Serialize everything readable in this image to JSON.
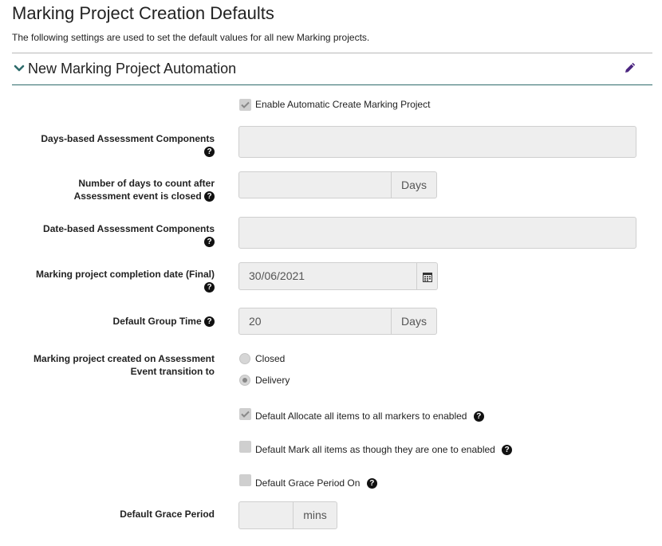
{
  "page": {
    "title": "Marking Project Creation Defaults",
    "subtitle": "The following settings are used to set the default values for all new Marking projects."
  },
  "section": {
    "title": "New Marking Project Automation",
    "collapse_icon": "chevron-down-icon",
    "edit_icon": "pencil-icon",
    "accent_color": "#2e6b6b",
    "edit_icon_color": "#4b2580"
  },
  "form": {
    "enable_auto": {
      "label": "Enable Automatic Create Marking Project",
      "checked": true
    },
    "days_based": {
      "label_line1": "Days-based Assessment Components",
      "value": ""
    },
    "days_count": {
      "label_line1": "Number of days to count after",
      "label_line2": "Assessment event is closed",
      "value": "",
      "addon": "Days"
    },
    "date_based": {
      "label_line1": "Date-based Assessment Components",
      "value": ""
    },
    "completion_date": {
      "label_line1": "Marking project completion date (Final)",
      "value": "30/06/2021",
      "icon": "calendar-icon"
    },
    "group_time": {
      "label": "Default Group Time",
      "value": "20",
      "addon": "Days"
    },
    "transition": {
      "label_line1": "Marking project created on Assessment",
      "label_line2": "Event transition to",
      "options": [
        {
          "label": "Closed",
          "selected": false
        },
        {
          "label": "Delivery",
          "selected": true
        }
      ]
    },
    "allocate_all": {
      "label": "Default Allocate all items to all markers to enabled",
      "checked": true
    },
    "mark_all": {
      "label": "Default Mark all items as though they are one to enabled",
      "checked": false
    },
    "grace_on": {
      "label": "Default Grace Period On",
      "checked": false
    },
    "grace_period": {
      "label": "Default Grace Period",
      "value": "",
      "addon": "mins"
    }
  }
}
